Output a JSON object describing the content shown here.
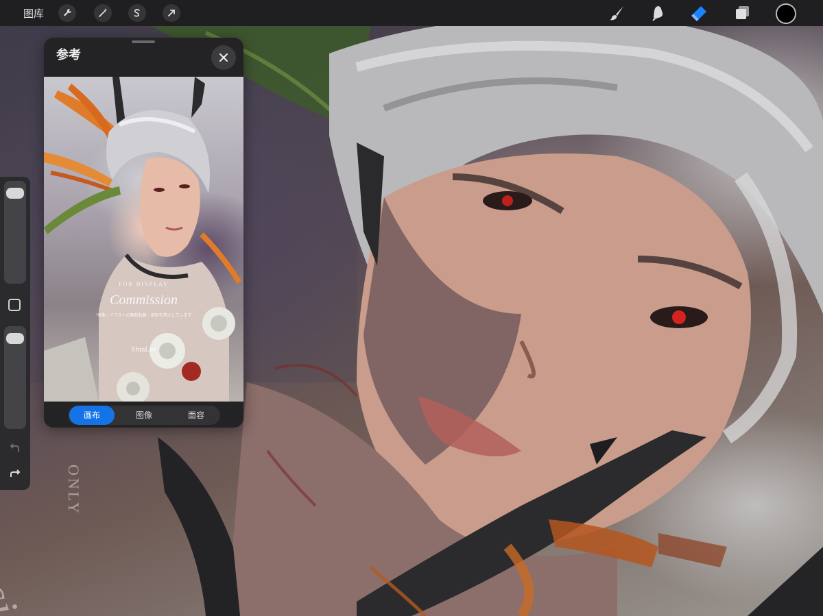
{
  "topbar": {
    "gallery_label": "图库",
    "left_tools": [
      "wrench-icon",
      "magic-wand-icon",
      "selection-icon",
      "transform-arrow-icon"
    ],
    "right_tools": [
      "brush-icon",
      "smudge-icon",
      "eraser-icon",
      "layers-icon"
    ],
    "active_tool": "eraser",
    "current_color": "#000000",
    "accent_color": "#1a84ff"
  },
  "sidebar": {
    "brush_size_level": 0.97,
    "opacity_level": 0.97
  },
  "reference_panel": {
    "title": "参考",
    "tabs": [
      {
        "label": "画布",
        "active": true
      },
      {
        "label": "图像",
        "active": false
      },
      {
        "label": "面容",
        "active": false
      }
    ],
    "image": {
      "watermark_for_display": "FOR DISPLAY",
      "watermark_commission": "Commission",
      "watermark_fine_print": "*肖像・イラストの無断転載・使用を禁止しています",
      "watermark_artist": "ShinLee"
    }
  },
  "canvas": {
    "text_only": "ONLY",
    "text_commission_fragment": "issi"
  }
}
